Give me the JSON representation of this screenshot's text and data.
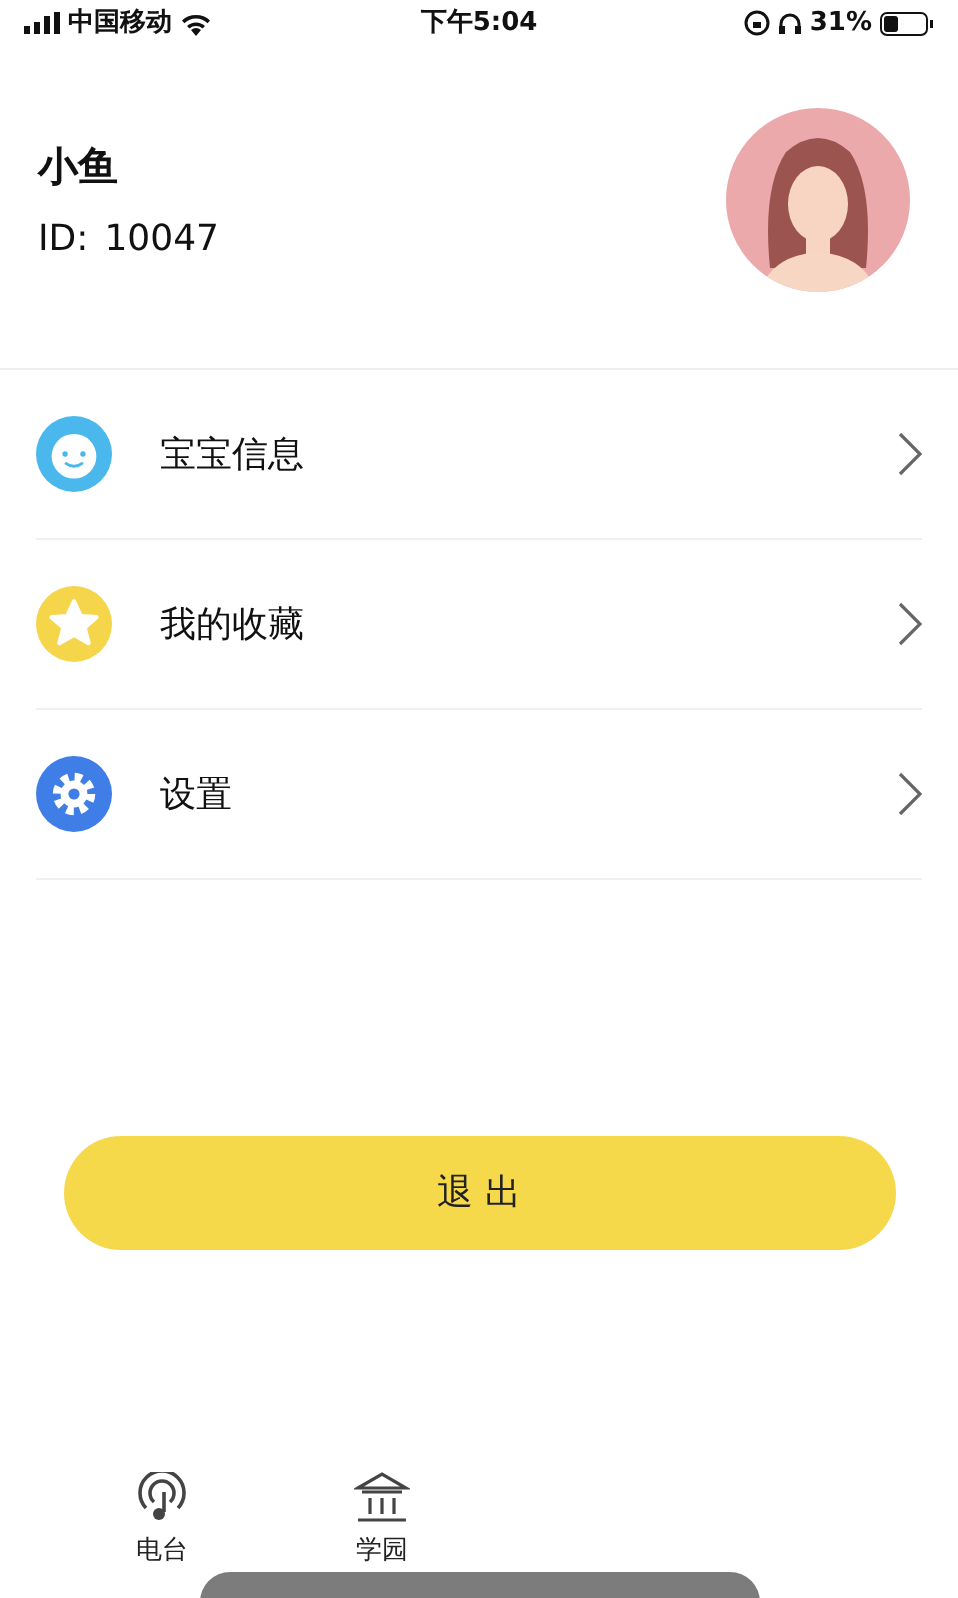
{
  "status_bar": {
    "carrier": "中国移动",
    "time": "下午5:04",
    "battery": "31%"
  },
  "profile": {
    "name": "小鱼",
    "id_label": "ID:",
    "id_value": "10047"
  },
  "menu": [
    {
      "label": "宝宝信息",
      "color": "#4ab8ec"
    },
    {
      "label": "我的收藏",
      "color": "#f5d54a"
    },
    {
      "label": "设置",
      "color": "#3f7ee6"
    }
  ],
  "logout_button": "退 出",
  "tab_bar": [
    {
      "label": "电台"
    },
    {
      "label": "学园"
    }
  ]
}
